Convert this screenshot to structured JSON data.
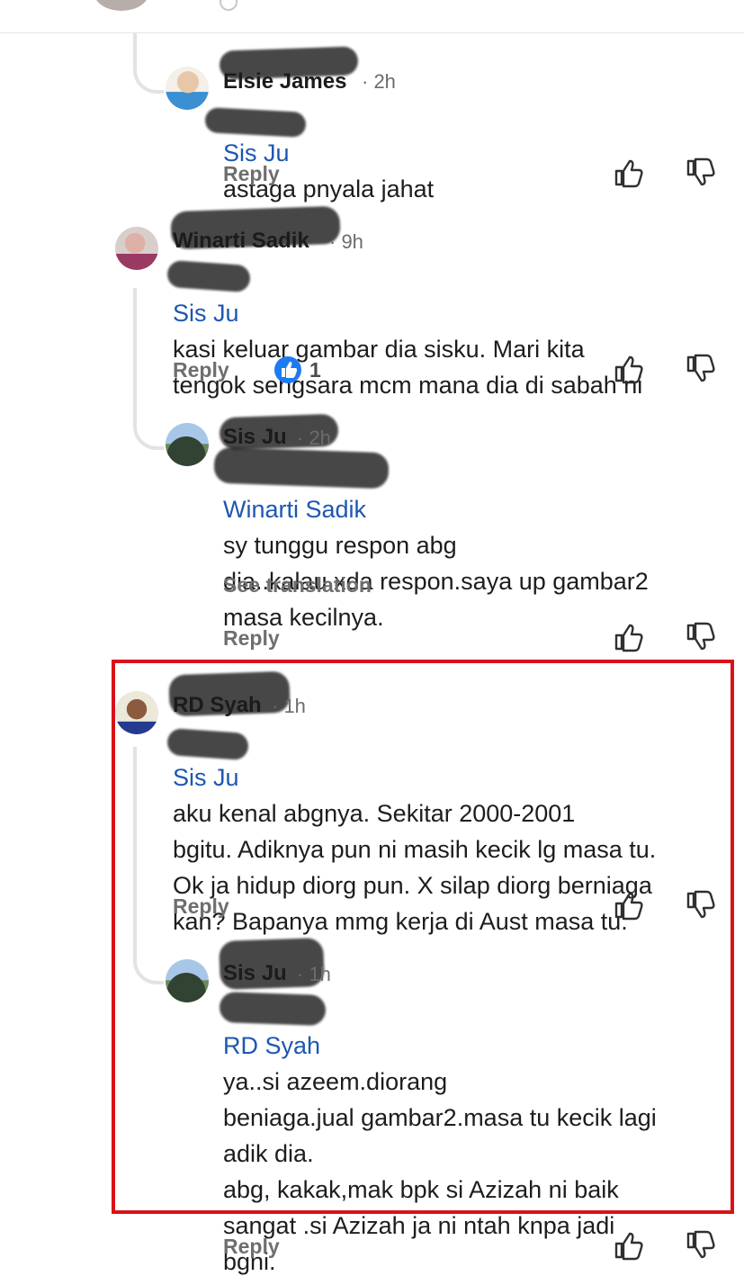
{
  "colors": {
    "mention": "#1d57b2",
    "highlight": "#d81318",
    "action_text": "#6e6e6e",
    "like_badge": "#1d7bf2"
  },
  "actions": {
    "reply": "Reply",
    "see_translation": "See translation",
    "like_icon": "thumbs-up-icon",
    "dislike_icon": "thumbs-down-icon"
  },
  "comments": [
    {
      "name": "Elsie James",
      "time": "· 2h",
      "mention": "Sis Ju",
      "body": "astaga pnyala jahat"
    },
    {
      "name": "Winarti Sadik",
      "time": "· 9h",
      "mention": "Sis Ju",
      "body": "kasi keluar gambar dia sisku. Mari kita\ntengok sengsara mcm mana dia di sabah ni",
      "reaction_count": "1"
    },
    {
      "name": "Sis Ju",
      "time": "· 2h",
      "mention": "Winarti Sadik",
      "body": "sy tunggu respon abg\ndia..kalau xda respon.saya up gambar2\nmasa kecilnya."
    },
    {
      "name": "RD Syah",
      "time": "· 1h",
      "mention": "Sis Ju",
      "body": "aku kenal abgnya. Sekitar 2000-2001\nbgitu. Adiknya pun ni masih kecik lg masa tu.\nOk ja hidup diorg pun. X silap diorg berniaga\nkan? Bapanya mmg kerja di Aust masa tu."
    },
    {
      "name": "Sis Ju",
      "time": "· 1h",
      "mention": "RD Syah",
      "body": "ya..si azeem.diorang\nbeniaga.jual gambar2.masa tu kecik lagi\nadik dia.\nabg, kakak,mak bpk si Azizah ni baik\nsangat .si Azizah ja ni ntah knpa jadi\nbgni."
    }
  ]
}
